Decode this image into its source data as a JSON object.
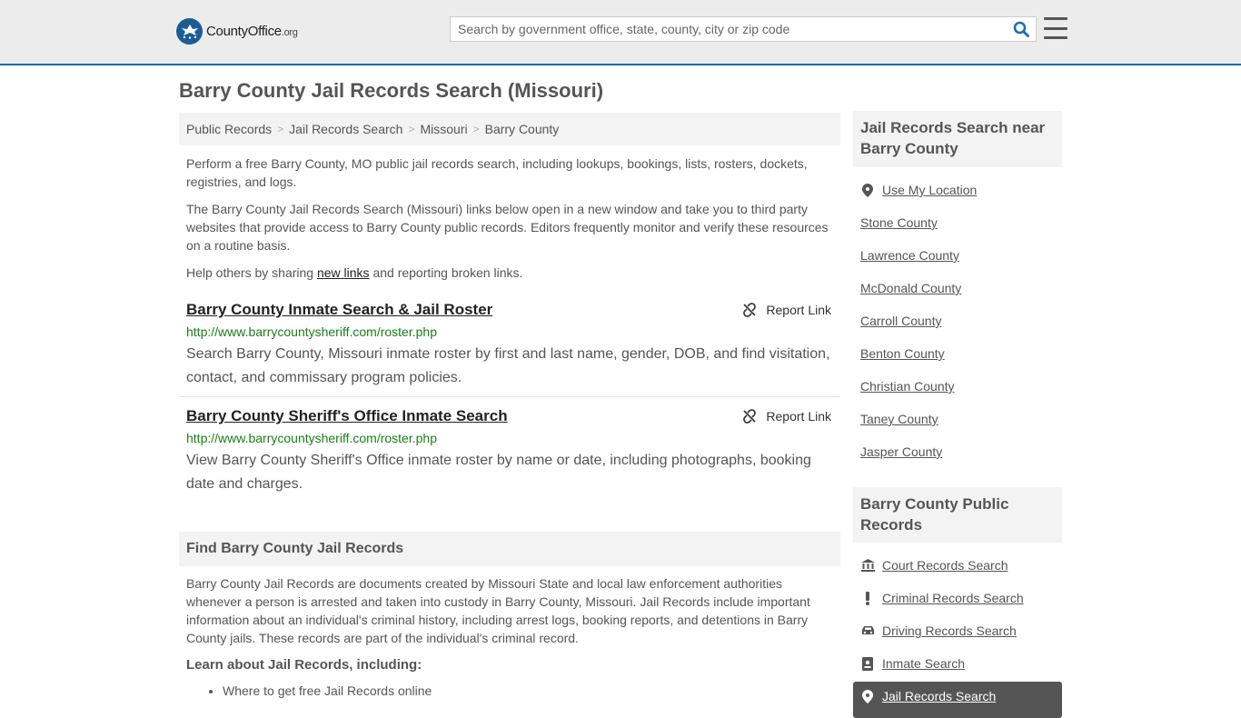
{
  "header": {
    "logo_main": "CountyOffice",
    "logo_tld": ".org",
    "search_placeholder": "Search by government office, state, county, city or zip code",
    "search_icon": "search-icon",
    "menu_icon": "hamburger-menu-icon"
  },
  "page": {
    "title": "Barry County Jail Records Search (Missouri)"
  },
  "breadcrumb": [
    "Public Records",
    "Jail Records Search",
    "Missouri",
    "Barry County"
  ],
  "intro": {
    "p1": "Perform a free Barry County, MO public jail records search, including lookups, bookings, lists, rosters, dockets, registries, and logs.",
    "p2": "The Barry County Jail Records Search (Missouri) links below open in a new window and take you to third party websites that provide access to Barry County public records. Editors frequently monitor and verify these resources on a routine basis.",
    "p3_before": "Help others by sharing ",
    "p3_link": "new links",
    "p3_after": " and reporting broken links."
  },
  "results": [
    {
      "title": "Barry County Inmate Search & Jail Roster",
      "url": "http://www.barrycountysheriff.com/roster.php",
      "description": "Search Barry County, Missouri inmate roster by first and last name, gender, DOB, and find visitation, contact, and commissary program policies.",
      "report_label": "Report Link"
    },
    {
      "title": "Barry County Sheriff's Office Inmate Search",
      "url": "http://www.barrycountysheriff.com/roster.php",
      "description": "View Barry County Sheriff's Office inmate roster by name or date, including photographs, booking date and charges.",
      "report_label": "Report Link"
    }
  ],
  "find_section": {
    "heading": "Find Barry County Jail Records",
    "body": "Barry County Jail Records are documents created by Missouri State and local law enforcement authorities whenever a person is arrested and taken into custody in Barry County, Missouri. Jail Records include important information about an individual's criminal history, including arrest logs, booking reports, and detentions in Barry County jails. These records are part of the individual's criminal record.",
    "learn_heading": "Learn about Jail Records, including:",
    "learn_items": [
      "Where to get free Jail Records online"
    ]
  },
  "sidebar": {
    "nearby_heading": "Jail Records Search near Barry County",
    "use_location": "Use My Location",
    "nearby": [
      "Stone County",
      "Lawrence County",
      "McDonald County",
      "Carroll County",
      "Benton County",
      "Christian County",
      "Taney County",
      "Jasper County"
    ],
    "public_heading": "Barry County Public Records",
    "public_links": [
      "Court Records Search",
      "Criminal Records Search",
      "Driving Records Search",
      "Inmate Search"
    ],
    "active_link": "Jail Records Search"
  },
  "colors": {
    "header_bg": "#ececec",
    "header_border": "#0f6aa8",
    "url_green": "#1a7f1a",
    "search_icon_blue": "#1b6fb5",
    "active_bg": "#555555"
  }
}
